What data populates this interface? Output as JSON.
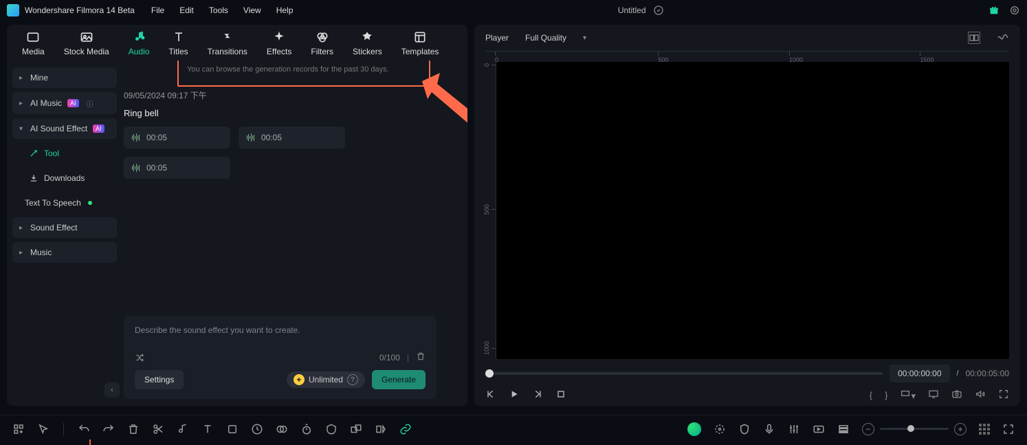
{
  "app_title": "Wondershare Filmora 14 Beta",
  "menu": {
    "file": "File",
    "edit": "Edit",
    "tools": "Tools",
    "view": "View",
    "help": "Help"
  },
  "doc_title": "Untitled",
  "tabs": {
    "media": "Media",
    "stock": "Stock Media",
    "audio": "Audio",
    "titles": "Titles",
    "transitions": "Transitions",
    "effects": "Effects",
    "filters": "Filters",
    "stickers": "Stickers",
    "templates": "Templates"
  },
  "sidebar": {
    "mine": "Mine",
    "ai_music": "AI Music",
    "ai_sfx": "AI Sound Effect",
    "tool": "Tool",
    "downloads": "Downloads",
    "tts": "Text To Speech",
    "sound_effect": "Sound Effect",
    "music": "Music",
    "ai_badge": "AI"
  },
  "hint_text": "You can browse the generation records for the past 30 days.",
  "timestamp": "09/05/2024 09:17 下午",
  "clip_title": "Ring bell",
  "clips": [
    {
      "dur": "00:05"
    },
    {
      "dur": "00:05"
    },
    {
      "dur": "00:05"
    }
  ],
  "gen": {
    "placeholder": "Describe the sound effect you want to create.",
    "counter": "0/100",
    "settings": "Settings",
    "unlimited": "Unlimited",
    "generate": "Generate"
  },
  "player": {
    "label": "Player",
    "quality": "Full Quality",
    "ruler": [
      "0",
      "500",
      "1000",
      "1500"
    ],
    "vruler": [
      "0",
      "500",
      "1000"
    ],
    "current": "00:00:00:00",
    "total": "00:00:05:00",
    "sep": "/"
  }
}
